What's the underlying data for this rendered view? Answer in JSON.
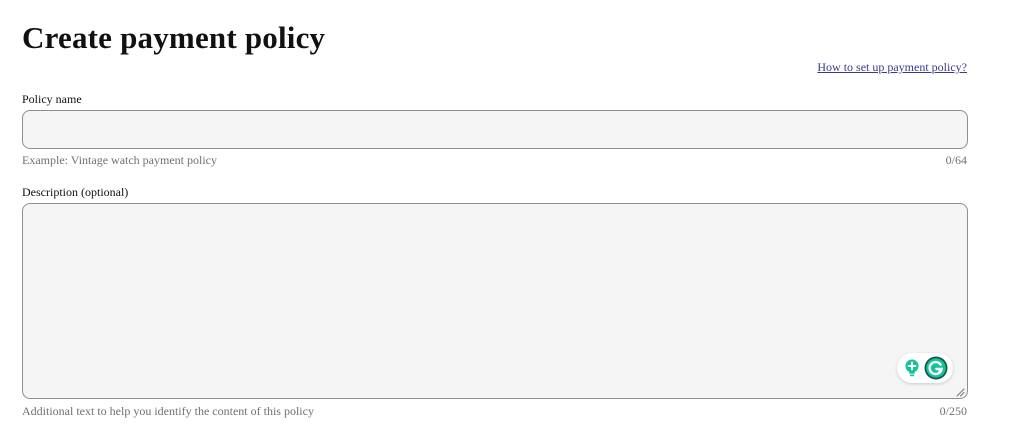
{
  "page": {
    "title": "Create payment policy",
    "help_link": "How to set up payment policy?"
  },
  "policy_name": {
    "label": "Policy name",
    "value": "",
    "placeholder": "",
    "hint": "Example: Vintage watch payment policy",
    "counter": "0/64"
  },
  "description": {
    "label": "Description (optional)",
    "value": "",
    "placeholder": "",
    "hint": "Additional text to help you identify the content of this policy",
    "counter": "0/250"
  },
  "extension": {
    "bulb_icon": "lightbulb-icon",
    "grammarly_icon": "grammarly-icon",
    "accent_color": "#15c39a",
    "dark_color": "#0d5c4a"
  },
  "colors": {
    "field_background": "#f5f5f5",
    "field_border": "#8f8f8f",
    "link": "#3a3a8c",
    "hint_text": "#707070"
  }
}
